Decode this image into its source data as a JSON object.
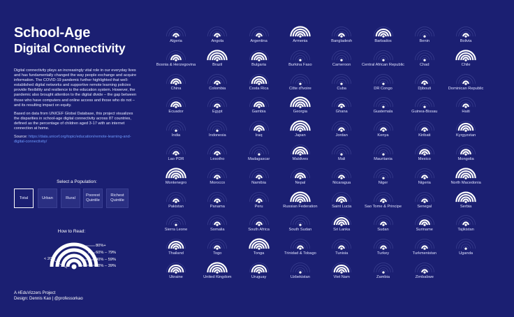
{
  "title_line1": "School-Age",
  "title_line2": "Digital Connectivity",
  "description_p1": "Digital connectivity plays an increasingly vital role in our everyday lives and has fundamentally changed the way people exchange and acquire information. The COVID-19 pandemic further highlighted that well-established digital networks and supportive remote learning policies provide flexibility and resilience to the education system. However, the pandemic also brought attention to the digital divide – the gap between those who have computers and online access and those who do not – and its resulting impact on equity.",
  "description_p2": "Based on data from UNICEF Global Database, this project visualizes the disparities in school-age digital connectivity across 87 countries, defined as the percentage of children aged 3-17 with an internet connection at home.",
  "source_label": "Source:",
  "source_url": "https://data.unicef.org/topic/education/remote-learning-and-digital-connectivity/",
  "select_label": "Select a Population:",
  "population_buttons": [
    "Total",
    "Urban",
    "Rural",
    "Poorest Quintile",
    "Richest Quintile"
  ],
  "active_population": "Total",
  "how_to_read_label": "How to Read:",
  "legend": {
    "lt20": "< 20%",
    "b80": "80%+",
    "b60": "60% – 79%",
    "b40": "40% – 59%",
    "b20": "20% – 39%"
  },
  "footer_line1": "A #EduVizzers Project",
  "footer_line2": "Design: Dennis Kao | @professorkao",
  "colors": {
    "background": "#1b1f72",
    "active_arc": "#ffffff",
    "inactive_arc": "#3a3f8f",
    "link": "#6f9bff"
  },
  "icon": "wifi-icon",
  "countries": [
    {
      "name": "Algeria",
      "level": 1
    },
    {
      "name": "Angola",
      "level": 1
    },
    {
      "name": "Argentina",
      "level": 1
    },
    {
      "name": "Armenia",
      "level": 4
    },
    {
      "name": "Bangladesh",
      "level": 1
    },
    {
      "name": "Barbados",
      "level": 3
    },
    {
      "name": "Benin",
      "level": 0
    },
    {
      "name": "Bolivia",
      "level": 1
    },
    {
      "name": "Bosnia & Herzegovina",
      "level": 2
    },
    {
      "name": "Brazil",
      "level": 4
    },
    {
      "name": "Bulgaria",
      "level": 3
    },
    {
      "name": "Burkina Faso",
      "level": 0
    },
    {
      "name": "Cameroon",
      "level": 0
    },
    {
      "name": "Central African Republic",
      "level": 0
    },
    {
      "name": "Chad",
      "level": 0
    },
    {
      "name": "Chile",
      "level": 4
    },
    {
      "name": "China",
      "level": 2
    },
    {
      "name": "Colombia",
      "level": 1
    },
    {
      "name": "Costa Rica",
      "level": 3
    },
    {
      "name": "Côte d'Ivoire",
      "level": 0
    },
    {
      "name": "Cuba",
      "level": 0
    },
    {
      "name": "DR Congo",
      "level": 0
    },
    {
      "name": "Djibouti",
      "level": 1
    },
    {
      "name": "Dominican Republic",
      "level": 1
    },
    {
      "name": "Ecuador",
      "level": 2
    },
    {
      "name": "Egypt",
      "level": 1
    },
    {
      "name": "Gambia",
      "level": 2
    },
    {
      "name": "Georgia",
      "level": 4
    },
    {
      "name": "Ghana",
      "level": 1
    },
    {
      "name": "Guatemala",
      "level": 0
    },
    {
      "name": "Guinea-Bissau",
      "level": 0
    },
    {
      "name": "Haiti",
      "level": 1
    },
    {
      "name": "India",
      "level": 0
    },
    {
      "name": "Indonesia",
      "level": 0
    },
    {
      "name": "Iraq",
      "level": 2
    },
    {
      "name": "Japan",
      "level": 4
    },
    {
      "name": "Jordan",
      "level": 1
    },
    {
      "name": "Kenya",
      "level": 1
    },
    {
      "name": "Kiribati",
      "level": 1
    },
    {
      "name": "Kyrgyzstan",
      "level": 3
    },
    {
      "name": "Lao PDR",
      "level": 1
    },
    {
      "name": "Lesotho",
      "level": 1
    },
    {
      "name": "Madagascar",
      "level": 0
    },
    {
      "name": "Maldives",
      "level": 3
    },
    {
      "name": "Mali",
      "level": 0
    },
    {
      "name": "Mauritania",
      "level": 0
    },
    {
      "name": "Mexico",
      "level": 2
    },
    {
      "name": "Mongolia",
      "level": 2
    },
    {
      "name": "Montenegro",
      "level": 4
    },
    {
      "name": "Morocco",
      "level": 1
    },
    {
      "name": "Namibia",
      "level": 1
    },
    {
      "name": "Nepal",
      "level": 2
    },
    {
      "name": "Nicaragua",
      "level": 1
    },
    {
      "name": "Niger",
      "level": 0
    },
    {
      "name": "Nigeria",
      "level": 1
    },
    {
      "name": "North Macedonia",
      "level": 4
    },
    {
      "name": "Pakistan",
      "level": 1
    },
    {
      "name": "Panama",
      "level": 1
    },
    {
      "name": "Peru",
      "level": 1
    },
    {
      "name": "Russian Federation",
      "level": 4
    },
    {
      "name": "Saint Lucia",
      "level": 2
    },
    {
      "name": "Sao Tome & Principe",
      "level": 1
    },
    {
      "name": "Senegal",
      "level": 1
    },
    {
      "name": "Serbia",
      "level": 4
    },
    {
      "name": "Sierra Leone",
      "level": 0
    },
    {
      "name": "Somalia",
      "level": 1
    },
    {
      "name": "South Africa",
      "level": 1
    },
    {
      "name": "South Sudan",
      "level": 0
    },
    {
      "name": "Sri Lanka",
      "level": 3
    },
    {
      "name": "Sudan",
      "level": 1
    },
    {
      "name": "Suriname",
      "level": 2
    },
    {
      "name": "Tajikistan",
      "level": 1
    },
    {
      "name": "Thailand",
      "level": 3
    },
    {
      "name": "Togo",
      "level": 1
    },
    {
      "name": "Tonga",
      "level": 4
    },
    {
      "name": "Trinidad & Tobago",
      "level": 1
    },
    {
      "name": "Tunisia",
      "level": 1
    },
    {
      "name": "Turkey",
      "level": 1
    },
    {
      "name": "Turkmenistan",
      "level": 1
    },
    {
      "name": "Uganda",
      "level": 0
    },
    {
      "name": "Ukraine",
      "level": 3
    },
    {
      "name": "United Kingdom",
      "level": 4
    },
    {
      "name": "Uruguay",
      "level": 3
    },
    {
      "name": "Uzbekistan",
      "level": 0
    },
    {
      "name": "Viet Nam",
      "level": 3
    },
    {
      "name": "Zambia",
      "level": 0
    },
    {
      "name": "Zimbabwe",
      "level": 1
    }
  ]
}
